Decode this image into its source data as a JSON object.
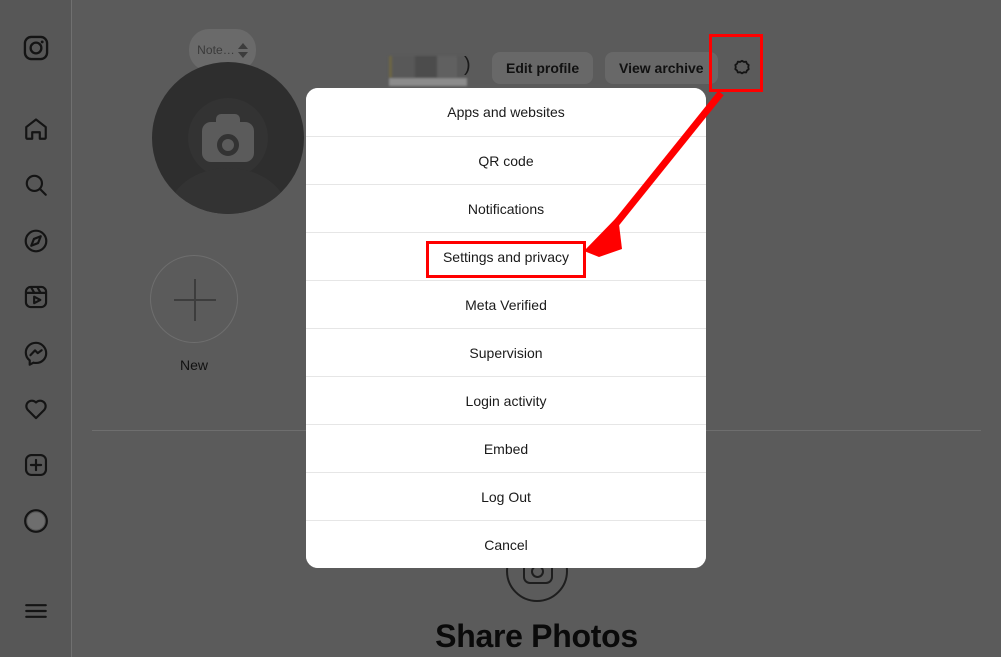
{
  "app": {
    "name": "Instagram",
    "background_color": "#5b5b5b",
    "overlay_dim": true
  },
  "sidebar": {
    "logo": {
      "icon": "instagram-logo-icon"
    },
    "items": [
      {
        "icon": "home-icon",
        "label": "Home"
      },
      {
        "icon": "search-icon",
        "label": "Search"
      },
      {
        "icon": "compass-icon",
        "label": "Explore"
      },
      {
        "icon": "reels-icon",
        "label": "Reels"
      },
      {
        "icon": "messenger-icon",
        "label": "Messages"
      },
      {
        "icon": "heart-icon",
        "label": "Notifications"
      },
      {
        "icon": "plus-square-icon",
        "label": "Create"
      },
      {
        "icon": "avatar-icon",
        "label": "Profile"
      }
    ],
    "more": {
      "icon": "hamburger-menu-icon",
      "label": "More"
    }
  },
  "profile": {
    "note_bubble": {
      "text": "Note…"
    },
    "avatar": {
      "icon": "camera-avatar-placeholder-icon"
    },
    "username_redacted": true,
    "username_trailing": ")",
    "edit_profile_label": "Edit profile",
    "view_archive_label": "View archive",
    "settings_icon": "gear-icon",
    "highlights": [
      {
        "label": "New",
        "icon": "plus-icon"
      }
    ]
  },
  "empty_state": {
    "icon": "camera-circle-icon",
    "title": "Share Photos"
  },
  "modal": {
    "title": "",
    "items": [
      {
        "label": "Apps and websites",
        "highlighted": false
      },
      {
        "label": "QR code",
        "highlighted": false
      },
      {
        "label": "Notifications",
        "highlighted": false
      },
      {
        "label": "Settings and privacy",
        "highlighted": true
      },
      {
        "label": "Meta Verified",
        "highlighted": false
      },
      {
        "label": "Supervision",
        "highlighted": false
      },
      {
        "label": "Login activity",
        "highlighted": false
      },
      {
        "label": "Embed",
        "highlighted": false
      },
      {
        "label": "Log Out",
        "highlighted": false
      },
      {
        "label": "Cancel",
        "highlighted": false
      }
    ]
  },
  "annotations": {
    "highlight_color": "#ff0000",
    "arrow": {
      "from": "gear-icon",
      "to": "settings-and-privacy-menu-item"
    }
  }
}
